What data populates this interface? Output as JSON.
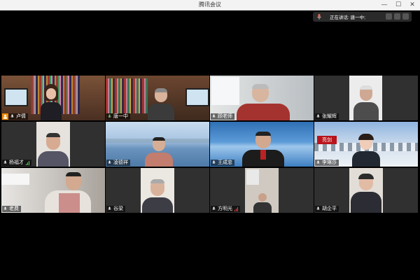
{
  "window": {
    "title": "腾讯会议"
  },
  "speaking_indicator": {
    "label": "正在讲话: 唐一中;"
  },
  "participants": [
    {
      "name": "卢倩",
      "host": true
    },
    {
      "name": "唐一中"
    },
    {
      "name": "顾老师"
    },
    {
      "name": "张耀辉"
    },
    {
      "name": "杨福才",
      "signal": true
    },
    {
      "name": "凌德祥"
    },
    {
      "name": "王成忠"
    },
    {
      "name": "李琳莎"
    },
    {
      "name": "老费"
    },
    {
      "name": "谷梁"
    },
    {
      "name": "方明光",
      "signal": true
    },
    {
      "name": "胡企平"
    }
  ],
  "background_text": {
    "banner": "亮剑"
  },
  "colors": {
    "host_badge": "#f08a00",
    "signal": "#5ed05e",
    "titlebar": "#f3f3f3"
  }
}
